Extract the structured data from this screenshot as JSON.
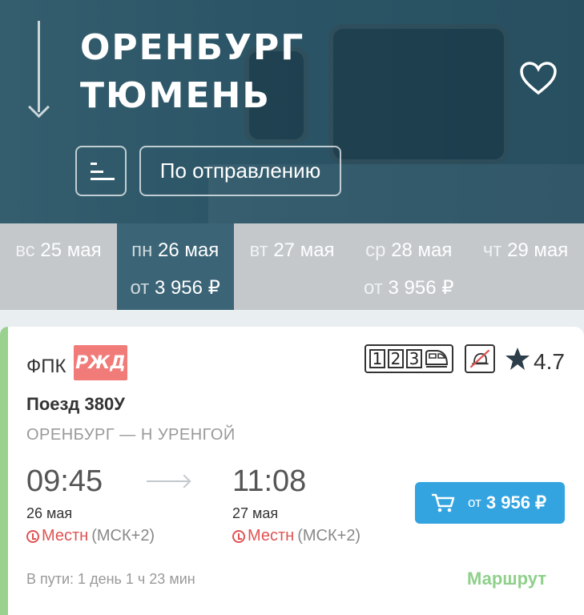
{
  "header": {
    "from_city": "ОРЕНБУРГ",
    "to_city": "ТЮМЕНЬ",
    "sort_order_label": "По отправлению",
    "icons": [
      "arrow-down-icon",
      "heart-icon",
      "sort-icon"
    ]
  },
  "dates": [
    {
      "weekday": "вс",
      "date": "25 мая",
      "price": ""
    },
    {
      "weekday": "пн",
      "date": "26 мая",
      "price_prefix": "от",
      "price": "3 956 ₽",
      "selected": true
    },
    {
      "weekday": "вт",
      "date": "27 мая",
      "price": ""
    },
    {
      "weekday": "ср",
      "date": "28 мая",
      "price_prefix": "от",
      "price": "3 956 ₽"
    },
    {
      "weekday": "чт",
      "date": "29 мая",
      "price": ""
    }
  ],
  "train": {
    "carrier": "ФПК",
    "logo_text": "РЖД",
    "class_numbers": [
      "1",
      "2",
      "3"
    ],
    "rating": "4.7",
    "number": "Поезд 380У",
    "route": "ОРЕНБУРГ — Н УРЕНГОЙ",
    "departure_time": "09:45",
    "arrival_time": "11:08",
    "departure_date": "26 мая",
    "arrival_date": "27 мая",
    "tz_label": "Местн",
    "tz_offset": "(МСК+2)",
    "buy_prefix": "от",
    "buy_price": "3 956 ₽",
    "travel_time": "В пути: 1 день 1 ч 23 мин",
    "route_link": "Маршрут"
  },
  "colors": {
    "header_bg": "#2b5566",
    "selected_date_bg": "#3b6476",
    "buy_button": "#33a4e0",
    "accent_green": "#8fd08a",
    "timezone_red": "#e05353",
    "rzd_logo": "#f07b78"
  }
}
